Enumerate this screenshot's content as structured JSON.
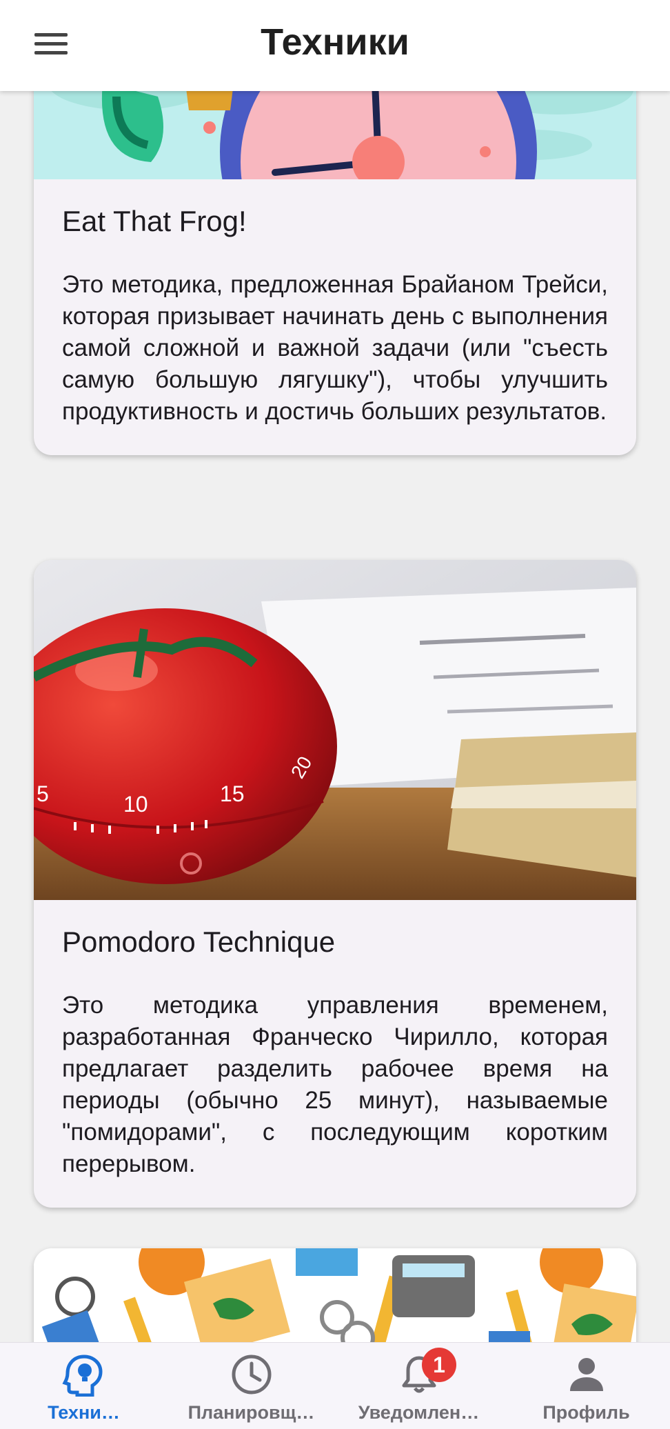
{
  "app_bar": {
    "title": "Техники",
    "menu_icon": "hamburger-menu-icon"
  },
  "cards": [
    {
      "title": "Eat That Frog!",
      "text": "Это методика, предложенная Брайаном Трейси, которая призывает начинать день с выполнения самой сложной и важной задачи (или \"съесть самую большую лягушку\"), чтобы улучшить продуктивность и достичь больших результатов.",
      "image": "clock-illustration"
    },
    {
      "title": "Pomodoro Technique",
      "text": "Это методика управления временем, разработанная Франческо Чирилло, которая предлагает разделить рабочее время на периоды (обычно 25 минут), называемые \"помидорами\", с последующим коротким перерывом.",
      "image": "tomato-timer-photo",
      "timer_marks": [
        "5",
        "10",
        "15",
        "20"
      ]
    },
    {
      "title": "",
      "text": "",
      "image": "school-supplies-pattern"
    }
  ],
  "bottom_nav": {
    "items": [
      {
        "label": "Техни…",
        "icon": "lightbulb-head-icon",
        "active": true
      },
      {
        "label": "Планировщ…",
        "icon": "clock-icon",
        "active": false
      },
      {
        "label": "Уведомлен…",
        "icon": "bell-icon",
        "active": false
      },
      {
        "label": "Профиль",
        "icon": "person-icon",
        "active": false
      }
    ],
    "notification_badge": "1"
  },
  "colors": {
    "accent": "#1a6fd6",
    "badge": "#e53935",
    "background": "#f0f0f0",
    "card": "#f5f2f7"
  }
}
